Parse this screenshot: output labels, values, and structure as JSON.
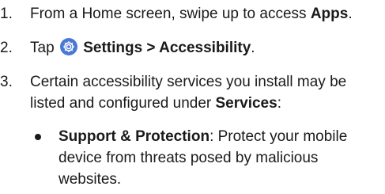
{
  "steps": [
    {
      "number": "1.",
      "before": "From a Home screen, swipe up to access ",
      "bold": "Apps",
      "after": "."
    },
    {
      "number": "2.",
      "before": "Tap ",
      "icon": "settings-gear-icon",
      "bold": "Settings > Accessibility",
      "after": "."
    },
    {
      "number": "3.",
      "before": "Certain accessibility services you install may be listed and configured under ",
      "bold": "Services",
      "after": ":"
    }
  ],
  "bullets": [
    {
      "bold": "Support & Protection",
      "text": ": Protect your mobile device from threats posed by malicious websites."
    }
  ],
  "colors": {
    "icon_bg": "#4a78d6",
    "text": "#1a1a1a"
  }
}
